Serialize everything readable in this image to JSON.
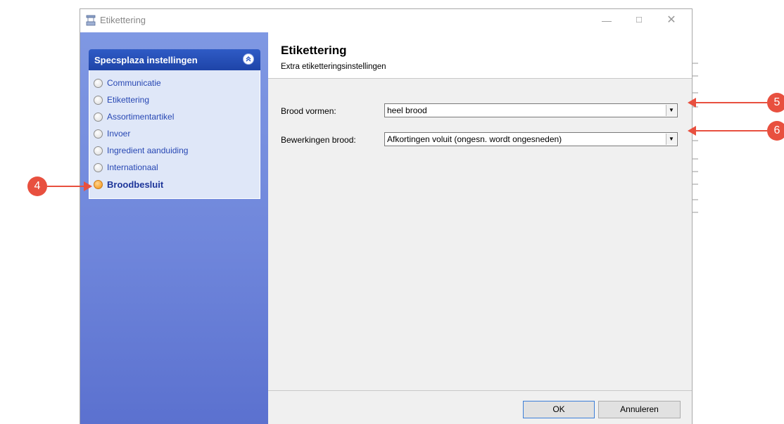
{
  "window": {
    "title": "Etikettering",
    "controls": {
      "minimize": "—",
      "maximize": "☐",
      "close": "✕"
    }
  },
  "sidebar": {
    "group_title": "Specsplaza instellingen",
    "collapse_icon": "«",
    "items": [
      {
        "label": "Communicatie",
        "active": false
      },
      {
        "label": "Etikettering",
        "active": false
      },
      {
        "label": "Assortimentartikel",
        "active": false
      },
      {
        "label": "Invoer",
        "active": false
      },
      {
        "label": "Ingredient aanduiding",
        "active": false
      },
      {
        "label": "Internationaal",
        "active": false
      },
      {
        "label": "Broodbesluit",
        "active": true
      }
    ]
  },
  "header": {
    "title": "Etikettering",
    "subtitle": "Extra etiketteringsinstellingen"
  },
  "form": {
    "brood_vormen": {
      "label": "Brood vormen:",
      "value": "heel brood"
    },
    "bewerkingen_brood": {
      "label": "Bewerkingen brood:",
      "value": "Afkortingen voluit (ongesn. wordt ongesneden)"
    }
  },
  "buttons": {
    "ok": "OK",
    "cancel": "Annuleren"
  },
  "markers": {
    "m4": "4",
    "m5": "5",
    "m6": "6"
  },
  "colors": {
    "accent_red": "#e8503f",
    "sidebar_header": "#1e44a8",
    "active_radio": "#f7a83b"
  }
}
